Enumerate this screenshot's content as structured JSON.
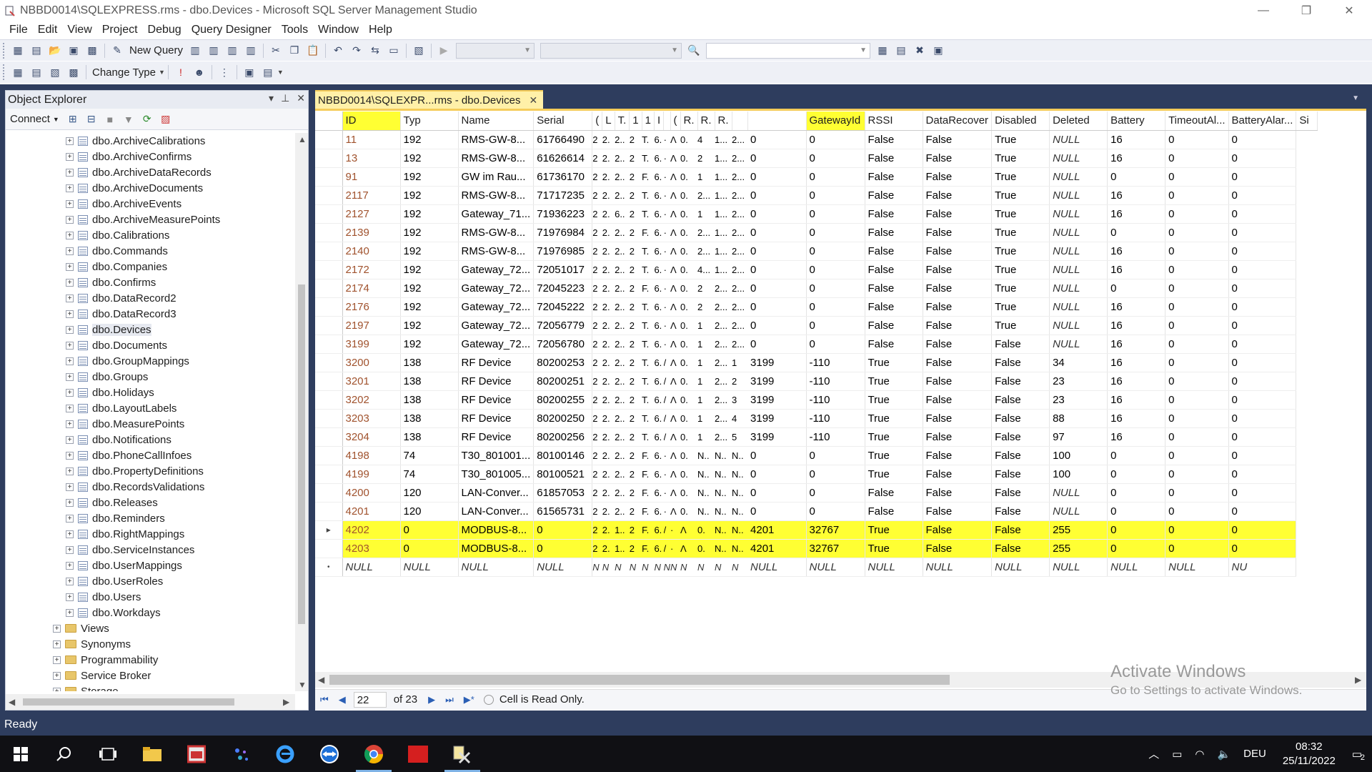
{
  "window": {
    "title": "NBBD0014\\SQLEXPRESS.rms - dbo.Devices - Microsoft SQL Server Management Studio",
    "minimize": "—",
    "restore": "❐",
    "close": "✕"
  },
  "menu": [
    "File",
    "Edit",
    "View",
    "Project",
    "Debug",
    "Query Designer",
    "Tools",
    "Window",
    "Help"
  ],
  "toolbar": {
    "new_query": "New Query",
    "change_type": "Change Type"
  },
  "object_explorer": {
    "title": "Object Explorer",
    "connect": "Connect",
    "tables": [
      "dbo.ArchiveCalibrations",
      "dbo.ArchiveConfirms",
      "dbo.ArchiveDataRecords",
      "dbo.ArchiveDocuments",
      "dbo.ArchiveEvents",
      "dbo.ArchiveMeasurePoints",
      "dbo.Calibrations",
      "dbo.Commands",
      "dbo.Companies",
      "dbo.Confirms",
      "dbo.DataRecord2",
      "dbo.DataRecord3",
      "dbo.Devices",
      "dbo.Documents",
      "dbo.GroupMappings",
      "dbo.Groups",
      "dbo.Holidays",
      "dbo.LayoutLabels",
      "dbo.MeasurePoints",
      "dbo.Notifications",
      "dbo.PhoneCallInfoes",
      "dbo.PropertyDefinitions",
      "dbo.RecordsValidations",
      "dbo.Releases",
      "dbo.Reminders",
      "dbo.RightMappings",
      "dbo.ServiceInstances",
      "dbo.UserMappings",
      "dbo.UserRoles",
      "dbo.Users",
      "dbo.Workdays"
    ],
    "folders": [
      "Views",
      "Synonyms",
      "Programmability",
      "Service Broker",
      "Storage"
    ],
    "selected": "dbo.Devices"
  },
  "doc_tab": {
    "label": "NBBD0014\\SQLEXPR...rms - dbo.Devices",
    "close": "✕"
  },
  "grid": {
    "columns": [
      "ID",
      "Typ",
      "Name",
      "Serial",
      "(",
      "L",
      "T.",
      "1",
      "1",
      "I",
      "(",
      "R.",
      "R.",
      "R.",
      "GatewayId",
      "RSSI",
      "DataRecover",
      "Disabled",
      "Deleted",
      "Battery",
      "TimeoutAl...",
      "BatteryAlar...",
      "Si"
    ],
    "highlight_columns": [
      0,
      14
    ],
    "rows": [
      [
        "11",
        "192",
        "RMS-GW-8...",
        "61766490",
        "2",
        "2.",
        "2..",
        "2",
        "T.",
        "6.",
        "·",
        "Λ",
        "0.",
        "4",
        "1...",
        "2...",
        "0",
        "0",
        "False",
        "False",
        "True",
        "NULL",
        "16",
        "0",
        "0"
      ],
      [
        "13",
        "192",
        "RMS-GW-8...",
        "61626614",
        "2",
        "2.",
        "2..",
        "2",
        "T.",
        "6.",
        "·",
        "Λ",
        "0.",
        "2",
        "1...",
        "2...",
        "0",
        "0",
        "False",
        "False",
        "True",
        "NULL",
        "16",
        "0",
        "0"
      ],
      [
        "91",
        "192",
        "GW im Rau...",
        "61736170",
        "2",
        "2.",
        "2..",
        "2",
        "F.",
        "6.",
        "·",
        "Λ",
        "0.",
        "1",
        "1...",
        "2...",
        "0",
        "0",
        "False",
        "False",
        "True",
        "NULL",
        "0",
        "0",
        "0"
      ],
      [
        "2117",
        "192",
        "RMS-GW-8...",
        "71717235",
        "2",
        "2.",
        "2..",
        "2",
        "T.",
        "6.",
        "·",
        "Λ",
        "0.",
        "2...",
        "1...",
        "2...",
        "0",
        "0",
        "False",
        "False",
        "True",
        "NULL",
        "16",
        "0",
        "0"
      ],
      [
        "2127",
        "192",
        "Gateway_71...",
        "71936223",
        "2",
        "2.",
        "6..",
        "2",
        "T.",
        "6.",
        "·",
        "Λ",
        "0.",
        "1",
        "1...",
        "2...",
        "0",
        "0",
        "False",
        "False",
        "True",
        "NULL",
        "16",
        "0",
        "0"
      ],
      [
        "2139",
        "192",
        "RMS-GW-8...",
        "71976984",
        "2",
        "2.",
        "2..",
        "2",
        "F.",
        "6.",
        "·",
        "Λ",
        "0.",
        "2...",
        "1...",
        "2...",
        "0",
        "0",
        "False",
        "False",
        "True",
        "NULL",
        "0",
        "0",
        "0"
      ],
      [
        "2140",
        "192",
        "RMS-GW-8...",
        "71976985",
        "2",
        "2.",
        "2..",
        "2",
        "T.",
        "6.",
        "·",
        "Λ",
        "0.",
        "2...",
        "1...",
        "2...",
        "0",
        "0",
        "False",
        "False",
        "True",
        "NULL",
        "16",
        "0",
        "0"
      ],
      [
        "2172",
        "192",
        "Gateway_72...",
        "72051017",
        "2",
        "2.",
        "2..",
        "2",
        "T.",
        "6.",
        "·",
        "Λ",
        "0.",
        "4...",
        "1...",
        "2...",
        "0",
        "0",
        "False",
        "False",
        "True",
        "NULL",
        "16",
        "0",
        "0"
      ],
      [
        "2174",
        "192",
        "Gateway_72...",
        "72045223",
        "2",
        "2.",
        "2..",
        "2",
        "F.",
        "6.",
        "·",
        "Λ",
        "0.",
        "2",
        "2...",
        "2...",
        "0",
        "0",
        "False",
        "False",
        "True",
        "NULL",
        "0",
        "0",
        "0"
      ],
      [
        "2176",
        "192",
        "Gateway_72...",
        "72045222",
        "2",
        "2.",
        "2..",
        "2",
        "T.",
        "6.",
        "·",
        "Λ",
        "0.",
        "2",
        "2...",
        "2...",
        "0",
        "0",
        "False",
        "False",
        "True",
        "NULL",
        "16",
        "0",
        "0"
      ],
      [
        "2197",
        "192",
        "Gateway_72...",
        "72056779",
        "2",
        "2.",
        "2..",
        "2",
        "T.",
        "6.",
        "·",
        "Λ",
        "0.",
        "1",
        "2...",
        "2...",
        "0",
        "0",
        "False",
        "False",
        "True",
        "NULL",
        "16",
        "0",
        "0"
      ],
      [
        "3199",
        "192",
        "Gateway_72...",
        "72056780",
        "2",
        "2.",
        "2..",
        "2",
        "T.",
        "6.",
        "·",
        "Λ",
        "0.",
        "1",
        "2...",
        "2...",
        "0",
        "0",
        "False",
        "False",
        "False",
        "NULL",
        "16",
        "0",
        "0"
      ],
      [
        "3200",
        "138",
        "RF Device",
        "80200253",
        "2",
        "2.",
        "2..",
        "2",
        "T.",
        "6.",
        "/",
        "Λ",
        "0.",
        "1",
        "2...",
        "1",
        "3199",
        "-110",
        "True",
        "False",
        "False",
        "34",
        "16",
        "0",
        "0"
      ],
      [
        "3201",
        "138",
        "RF Device",
        "80200251",
        "2",
        "2.",
        "2..",
        "2",
        "T.",
        "6.",
        "/",
        "Λ",
        "0.",
        "1",
        "2...",
        "2",
        "3199",
        "-110",
        "True",
        "False",
        "False",
        "23",
        "16",
        "0",
        "0"
      ],
      [
        "3202",
        "138",
        "RF Device",
        "80200255",
        "2",
        "2.",
        "2..",
        "2",
        "T.",
        "6.",
        "/",
        "Λ",
        "0.",
        "1",
        "2...",
        "3",
        "3199",
        "-110",
        "True",
        "False",
        "False",
        "23",
        "16",
        "0",
        "0"
      ],
      [
        "3203",
        "138",
        "RF Device",
        "80200250",
        "2",
        "2.",
        "2..",
        "2",
        "T.",
        "6.",
        "/",
        "Λ",
        "0.",
        "1",
        "2...",
        "4",
        "3199",
        "-110",
        "True",
        "False",
        "False",
        "88",
        "16",
        "0",
        "0"
      ],
      [
        "3204",
        "138",
        "RF Device",
        "80200256",
        "2",
        "2.",
        "2..",
        "2",
        "T.",
        "6.",
        "/",
        "Λ",
        "0.",
        "1",
        "2...",
        "5",
        "3199",
        "-110",
        "True",
        "False",
        "False",
        "97",
        "16",
        "0",
        "0"
      ],
      [
        "4198",
        "74",
        "T30_801001...",
        "80100146",
        "2",
        "2.",
        "2..",
        "2",
        "F.",
        "6.",
        "·",
        "Λ",
        "0.",
        "N..",
        "N..",
        "N..",
        "0",
        "0",
        "True",
        "False",
        "False",
        "100",
        "0",
        "0",
        "0"
      ],
      [
        "4199",
        "74",
        "T30_801005...",
        "80100521",
        "2",
        "2.",
        "2..",
        "2",
        "F.",
        "6.",
        "·",
        "Λ",
        "0.",
        "N..",
        "N..",
        "N..",
        "0",
        "0",
        "True",
        "False",
        "False",
        "100",
        "0",
        "0",
        "0"
      ],
      [
        "4200",
        "120",
        "LAN-Conver...",
        "61857053",
        "2",
        "2.",
        "2..",
        "2",
        "F.",
        "6.",
        "·",
        "Λ",
        "0.",
        "N..",
        "N..",
        "N..",
        "0",
        "0",
        "False",
        "False",
        "False",
        "NULL",
        "0",
        "0",
        "0"
      ],
      [
        "4201",
        "120",
        "LAN-Conver...",
        "61565731",
        "2",
        "2.",
        "2..",
        "2",
        "F.",
        "6.",
        "·",
        "Λ",
        "0.",
        "N..",
        "N..",
        "N..",
        "0",
        "0",
        "False",
        "False",
        "False",
        "NULL",
        "0",
        "0",
        "0"
      ],
      [
        "4202",
        "0",
        "MODBUS-8...",
        "0",
        "2",
        "2.",
        "1..",
        "2",
        "F.",
        "6.",
        "/",
        "·",
        "Λ",
        "0.",
        "N..",
        "N..",
        "4201",
        "32767",
        "True",
        "False",
        "False",
        "255",
        "0",
        "0",
        "0"
      ],
      [
        "4203",
        "0",
        "MODBUS-8...",
        "0",
        "2",
        "2.",
        "1..",
        "2",
        "F.",
        "6.",
        "/",
        "·",
        "Λ",
        "0.",
        "N..",
        "N..",
        "4201",
        "32767",
        "True",
        "False",
        "False",
        "255",
        "0",
        "0",
        "0"
      ]
    ],
    "new_row": "NULL",
    "new_row_letters": "N",
    "new_row_end": "NU"
  },
  "nav": {
    "position": "22",
    "of": "of 23",
    "status": "Cell is Read Only."
  },
  "activate": {
    "title": "Activate Windows",
    "sub": "Go to Settings to activate Windows."
  },
  "status": "Ready",
  "tray": {
    "lang": "DEU",
    "time": "08:32",
    "date": "25/11/2022",
    "notif": "2"
  },
  "colors": {
    "frame": "#2e3d5e",
    "highlight": "#ffff33",
    "tab": "#fff0a8"
  }
}
